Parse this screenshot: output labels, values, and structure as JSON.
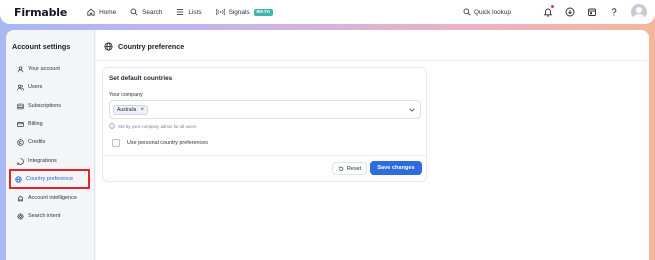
{
  "topbar": {
    "logo": "Firmable",
    "nav": [
      {
        "label": "Home",
        "icon": "home-icon"
      },
      {
        "label": "Search",
        "icon": "search-icon"
      },
      {
        "label": "Lists",
        "icon": "list-icon"
      },
      {
        "label": "Signals",
        "icon": "signal-icon",
        "badge": "BETA"
      }
    ],
    "quick_lookup": "Quick lookup",
    "icons": [
      "notification-bell-icon",
      "download-icon",
      "calendar-icon",
      "help-icon",
      "avatar"
    ]
  },
  "sidebar": {
    "title": "Account settings",
    "items": [
      {
        "label": "Your account",
        "icon": "user-icon"
      },
      {
        "label": "Users",
        "icon": "users-icon"
      },
      {
        "label": "Subscriptions",
        "icon": "subscriptions-icon"
      },
      {
        "label": "Billing",
        "icon": "billing-card-icon"
      },
      {
        "label": "Credits",
        "icon": "credits-icon"
      },
      {
        "label": "Integrations",
        "icon": "integrations-icon"
      },
      {
        "label": "Country preference",
        "icon": "globe-icon",
        "active": true
      },
      {
        "label": "Account intelligence",
        "icon": "intelligence-icon"
      },
      {
        "label": "Search intent",
        "icon": "search-intent-icon"
      }
    ]
  },
  "page": {
    "title": "Country preference",
    "card": {
      "title": "Set default countries",
      "field_label": "Your company",
      "selected_chip": "Australia",
      "hint": "Set by your company admin for all users",
      "checkbox_label": "Use personal country preferences",
      "checkbox_checked": false,
      "reset_label": "Reset",
      "save_label": "Save changes"
    }
  },
  "colors": {
    "accent": "#2f6be0",
    "active_nav_text": "#2c5fd6",
    "highlight_border": "#e02828",
    "beta_badge": "#3fb6a8"
  }
}
